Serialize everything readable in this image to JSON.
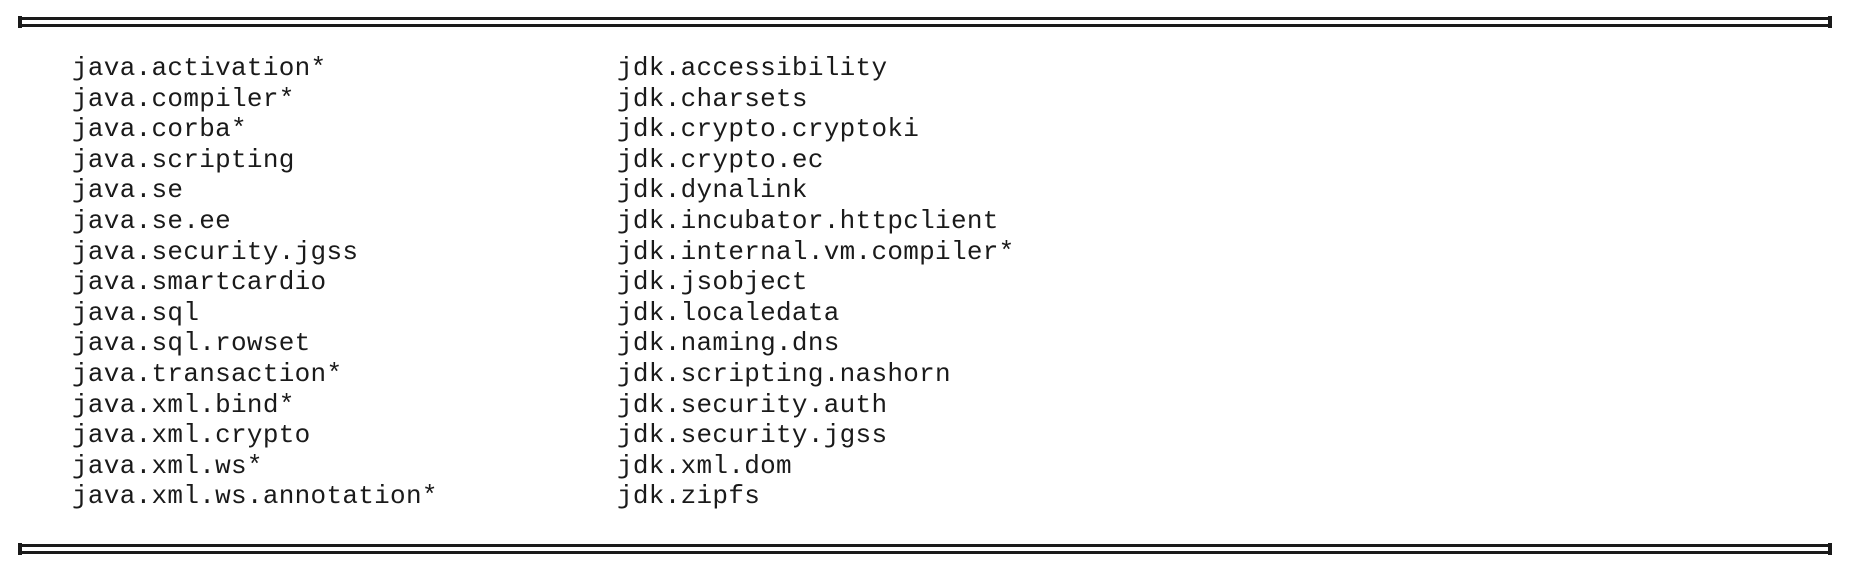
{
  "modules": {
    "left": [
      "java.activation*",
      "java.compiler*",
      "java.corba*",
      "java.scripting",
      "java.se",
      "java.se.ee",
      "java.security.jgss",
      "java.smartcardio",
      "java.sql",
      "java.sql.rowset",
      "java.transaction*",
      "java.xml.bind*",
      "java.xml.crypto",
      "java.xml.ws*",
      "java.xml.ws.annotation*"
    ],
    "right": [
      "jdk.accessibility",
      "jdk.charsets",
      "jdk.crypto.cryptoki",
      "jdk.crypto.ec",
      "jdk.dynalink",
      "jdk.incubator.httpclient",
      "jdk.internal.vm.compiler*",
      "jdk.jsobject",
      "jdk.localedata",
      "jdk.naming.dns",
      "jdk.scripting.nashorn",
      "jdk.security.auth",
      "jdk.security.jgss",
      "jdk.xml.dom",
      "jdk.zipfs"
    ]
  }
}
